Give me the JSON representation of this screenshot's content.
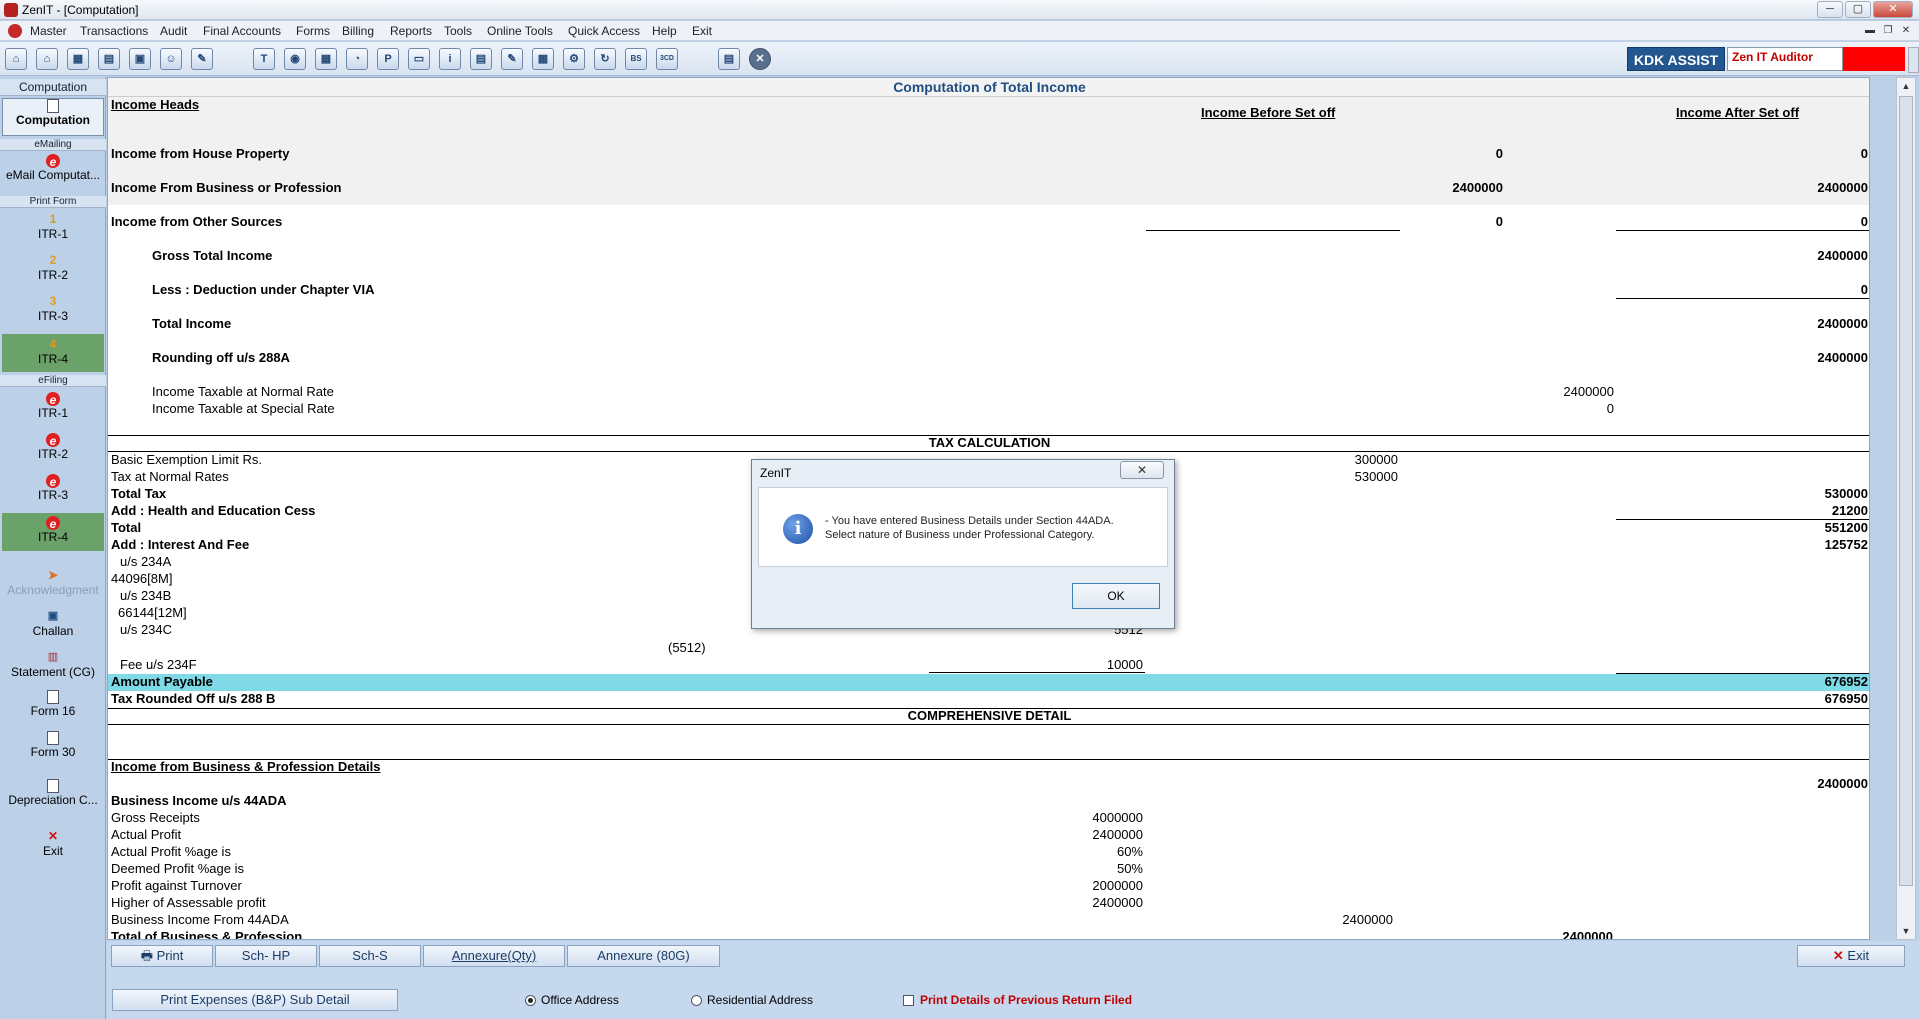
{
  "window": {
    "title": "ZenIT - [Computation]",
    "min": "─",
    "max": "▢",
    "close": "✕"
  },
  "menu": {
    "items": [
      "Master",
      "Transactions",
      "Audit",
      "Final Accounts",
      "Forms",
      "Billing",
      "Reports",
      "Tools",
      "Online Tools",
      "Quick Access",
      "Help",
      "Exit"
    ],
    "mdi_min": "▬",
    "mdi_restore": "❐",
    "mdi_close": "✕"
  },
  "toolbar": {
    "icons": [
      "home-icon",
      "house-icon",
      "building-icon",
      "bar-chart-icon",
      "gift-icon",
      "users-icon",
      "pen-icon",
      "tax-icon",
      "globe-icon",
      "calculator-icon",
      "pie-chart-icon",
      "pay-icon",
      "book-icon",
      "info-icon",
      "report-icon",
      "edit-doc-icon",
      "calendar-icon",
      "settings-doc-icon",
      "refresh-icon",
      "bs-icon",
      "3cd-icon",
      "form-icon",
      "close-circle-icon"
    ],
    "glyphs": [
      "⌂",
      "⌂",
      "▦",
      "▤",
      "▣",
      "☺",
      "✎",
      "T",
      "◉",
      "▦",
      "◔",
      "P",
      "▭",
      "i",
      "▤",
      "✎",
      "▦",
      "⚙",
      "↻",
      "BS",
      "3CD",
      "▤",
      "✕"
    ],
    "kdk_assist": "KDK ASSIST",
    "zen_auditor": "Zen IT Auditor",
    "accent_red": "#ff0000",
    "accent_blue": "#24568f"
  },
  "sidebar": {
    "header_computation": "Computation",
    "computation_label": "Computation",
    "emailing_header": "eMailing",
    "email_label": "eMail Computat...",
    "printform_header": "Print Form",
    "print_items": [
      {
        "num": "1",
        "label": "ITR-1"
      },
      {
        "num": "2",
        "label": "ITR-2"
      },
      {
        "num": "3",
        "label": "ITR-3"
      },
      {
        "num": "4",
        "label": "ITR-4"
      }
    ],
    "efiling_header": "eFiling",
    "efiling_items": [
      "ITR-1",
      "ITR-2",
      "ITR-3",
      "ITR-4"
    ],
    "acknowledgment": "Acknowledgment",
    "challan": "Challan",
    "statement": "Statement (CG)",
    "form16": "Form 16",
    "form30": "Form 30",
    "depreciation": "Depreciation C...",
    "exit": "Exit"
  },
  "computation": {
    "title": "Computation of Total Income",
    "income_heads": "Income Heads",
    "col_before": "Income Before Set off",
    "col_after": "Income After Set off",
    "rows": {
      "house_property": {
        "label": "Income from House Property",
        "before": "0",
        "after": "0"
      },
      "business": {
        "label": "Income From Business or Profession",
        "before": "2400000",
        "after": "2400000"
      },
      "other_sources": {
        "label": "Income from Other Sources",
        "before": "0",
        "after": "0"
      },
      "gross_total": {
        "label": "Gross Total Income",
        "after": "2400000"
      },
      "deduction": {
        "label": "Less : Deduction under Chapter VIA",
        "after": "0"
      },
      "total_income": {
        "label": "Total Income",
        "after": "2400000"
      },
      "rounding": {
        "label": "Rounding off u/s 288A",
        "after": "2400000"
      },
      "normal_rate": {
        "label": "Income Taxable at Normal Rate",
        "value": "2400000"
      },
      "special_rate": {
        "label": "Income Taxable at Special Rate",
        "value": "0"
      }
    }
  },
  "tax": {
    "header": "TAX CALCULATION",
    "basic_exemption": {
      "label": "Basic Exemption Limit Rs.",
      "value": "300000"
    },
    "tax_normal": {
      "label": "Tax at Normal Rates",
      "value": "530000"
    },
    "total_tax": {
      "label": "Total Tax",
      "value": "530000"
    },
    "cess": {
      "label": "Add : Health and Education Cess",
      "value": "21200"
    },
    "total": {
      "label": "Total",
      "value": "551200"
    },
    "interest_fee": {
      "label": "Add : Interest And Fee",
      "value": "125752"
    },
    "us234a": "u/s 234A",
    "us234a_detail": "44096[8M]",
    "us234b": "u/s 234B",
    "us234b_detail": "66144[12M]",
    "us234c": "u/s 234C",
    "us234c_value": "5512",
    "neg_value": "(5512)",
    "fee234f": {
      "label": "Fee u/s 234F",
      "value": "10000"
    },
    "amount_payable": {
      "label": "Amount Payable",
      "value": "676952"
    },
    "rounded": {
      "label": "Tax Rounded Off u/s 288 B",
      "value": "676950"
    }
  },
  "comprehensive": {
    "header": "COMPREHENSIVE DETAIL",
    "biz_details": "Income from Business & Profession Details",
    "biz_total": "2400000",
    "biz_44ada": "Business Income u/s 44ADA",
    "gross_receipts": {
      "label": "Gross Receipts",
      "value": "4000000"
    },
    "actual_profit": {
      "label": "Actual Profit",
      "value": "2400000"
    },
    "actual_pct": {
      "label": "Actual Profit %age is",
      "value": "60%"
    },
    "deemed_pct": {
      "label": "Deemed Profit %age is",
      "value": "50%"
    },
    "profit_turnover": {
      "label": "Profit against Turnover",
      "value": "2000000"
    },
    "higher_profit": {
      "label": "Higher of Assessable profit",
      "value": "2400000"
    },
    "from_44ada": {
      "label": "Business Income From 44ADA",
      "value": "2400000"
    },
    "total_bp": {
      "label": "Total of Business & Profession",
      "value": "2400000"
    }
  },
  "bottom": {
    "print": "Print",
    "sch_hp": "Sch- HP",
    "sch_s": "Sch-S",
    "annexure_qty": "Annexure(Qty)",
    "annexure_80g": "Annexure (80G)",
    "exit": "Exit",
    "print_expenses": "Print Expenses (B&P) Sub Detail",
    "office_address": "Office Address",
    "residential_address": "Residential Address",
    "print_prev": "Print Details of Previous Return Filed"
  },
  "dialog": {
    "title": "ZenIT",
    "close": "✕",
    "line1": "- You have entered Business Details under Section 44ADA.",
    "line2": "Select nature of Business under Professional Category.",
    "ok": "OK"
  }
}
